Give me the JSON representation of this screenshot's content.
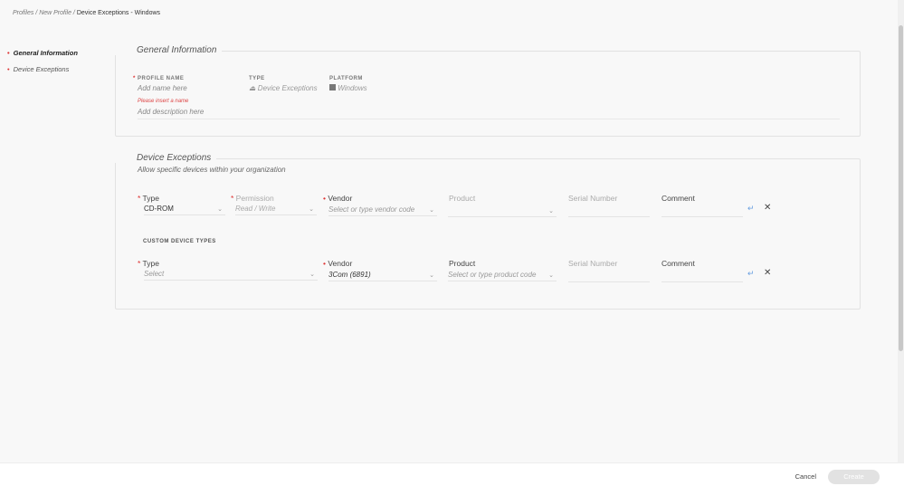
{
  "breadcrumb": [
    "Profiles",
    "New Profile",
    "Device Exceptions - Windows"
  ],
  "sidebar": {
    "items": [
      {
        "label": "General Information",
        "active": true
      },
      {
        "label": "Device Exceptions",
        "active": false
      }
    ]
  },
  "general": {
    "title": "General Information",
    "profile_name_label": "PROFILE NAME",
    "profile_name_placeholder": "Add name here",
    "error": "Please insert a name",
    "description_placeholder": "Add description here",
    "type_label": "TYPE",
    "type_value": "Device Exceptions",
    "platform_label": "PLATFORM",
    "platform_value": "Windows"
  },
  "exceptions": {
    "title": "Device Exceptions",
    "subtitle": "Allow specific devices within your organization",
    "row1": {
      "type_label": "Type",
      "type_value": "CD-ROM",
      "permission_label": "Permission",
      "permission_value": "Read / Write",
      "vendor_label": "Vendor",
      "vendor_placeholder": "Select or type vendor code",
      "product_label": "Product",
      "serial_label": "Serial Number",
      "comment_label": "Comment"
    },
    "custom_header": "CUSTOM DEVICE TYPES",
    "row2": {
      "type_label": "Type",
      "type_placeholder": "Select",
      "vendor_label": "Vendor",
      "vendor_value": "3Com (6891)",
      "product_label": "Product",
      "product_placeholder": "Select or type product code",
      "serial_label": "Serial Number",
      "comment_label": "Comment"
    }
  },
  "footer": {
    "cancel": "Cancel",
    "create": "Create"
  },
  "colors": {
    "required": "#dd3333",
    "accent": "#6aa0e0"
  }
}
